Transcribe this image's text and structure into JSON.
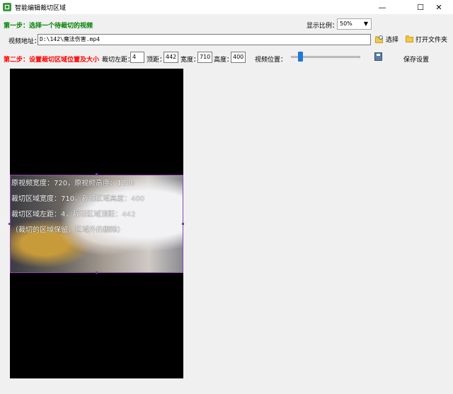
{
  "window": {
    "title": "智能编辑裁切区域",
    "minimize": "—",
    "maximize": "☐",
    "close": "✕"
  },
  "step1": {
    "label": "第一步：选择一个待裁切的视频",
    "ratio_label": "显示比例：",
    "ratio_value": "50%",
    "video_label": "视频地址：",
    "video_path": "D:\\142\\魔法伤害.mp4",
    "select_button": "选择",
    "open_folder_button": "打开文件夹"
  },
  "step2": {
    "label": "第二步：设置裁切区域位置及大小",
    "left_label": "裁切左距：",
    "left_value": "4",
    "top_label": "顶距：",
    "top_value": "442",
    "width_label": "宽度：",
    "width_value": "710",
    "height_label": "高度：",
    "height_value": "400",
    "position_label": "视频位置：",
    "position_value": 0.11,
    "save_button": "保存设置"
  },
  "overlay": {
    "line1": "原视频宽度：720，原视频高度：1280",
    "line2": "裁切区域宽度：710，裁切区域高度：400",
    "line3": "裁切区域左距：4，裁切区域顶距：442",
    "line4": "（裁切的区域保留，区域外的删除）"
  },
  "colors": {
    "step1": "#008000",
    "step2": "#ff0000",
    "crop_border": "#8e44ad",
    "slider_thumb": "#1e78d6"
  },
  "icons": {
    "app": "app-icon",
    "select": "magnifier-folder-icon",
    "open_folder": "folder-icon",
    "save": "save-icon"
  }
}
